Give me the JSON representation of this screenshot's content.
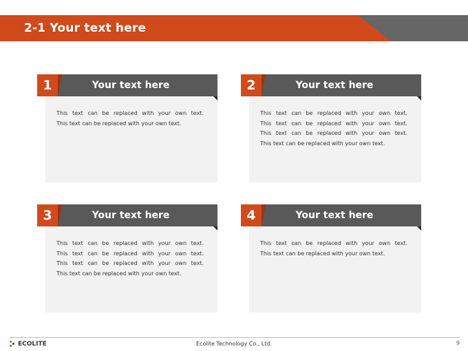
{
  "slide": {
    "title": "2-1 Your text here"
  },
  "cards": [
    {
      "number": "1",
      "heading": "Your text here",
      "lines": [
        "This text can be replaced with your own text.",
        "This text can be replaced with your own text."
      ]
    },
    {
      "number": "2",
      "heading": "Your text here",
      "lines": [
        "This text can be replaced with your own text.",
        "This text can be replaced with your own text.",
        "This text can be replaced with your own text.",
        "This text can be replaced with your own text."
      ]
    },
    {
      "number": "3",
      "heading": "Your text here",
      "lines": [
        "This text can be replaced with your own text.",
        "This text can be replaced with your own text.",
        "This text can be replaced with your own text.",
        "This text can be replaced with your own text."
      ]
    },
    {
      "number": "4",
      "heading": "Your text here",
      "lines": [
        "This text can be replaced with your own text.",
        "This text can be replaced with your own text."
      ]
    }
  ],
  "footer": {
    "logo_text": "ECOLITE",
    "company": "Ecolite Technology Co., Ltd.",
    "page_number": "9"
  },
  "colors": {
    "accent": "#d04a1c",
    "header_gray": "#595959",
    "card_bg": "#f2f2f2"
  },
  "icons": {
    "logo": "ecolite-dots-logo-icon"
  }
}
